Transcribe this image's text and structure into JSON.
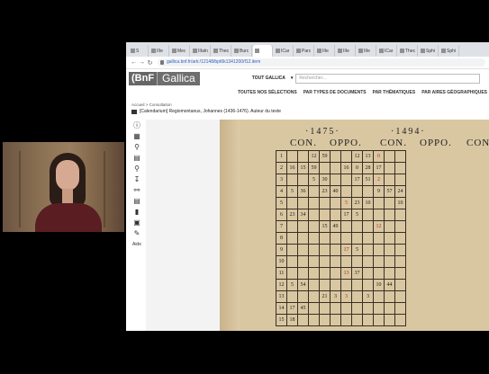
{
  "browser": {
    "tabs": [
      {
        "label": "S"
      },
      {
        "label": "IIIe"
      },
      {
        "label": "Mec"
      },
      {
        "label": "IIIaln"
      },
      {
        "label": "Thec"
      },
      {
        "label": "Burc"
      },
      {
        "label": "",
        "active": true
      },
      {
        "label": "ICar"
      },
      {
        "label": "Parc"
      },
      {
        "label": "IIIe"
      },
      {
        "label": "IIIe"
      },
      {
        "label": "IIIe"
      },
      {
        "label": "ICar"
      },
      {
        "label": "Thec"
      },
      {
        "label": "Sphi"
      },
      {
        "label": "Sphi"
      }
    ],
    "address": "gallica.bnf.fr/ark:/12148/bpt6k1341200/f12.item"
  },
  "header": {
    "logo_bnf": "(BnF",
    "logo_gallica": "Gallica",
    "scope": "TOUT GALLICA",
    "search_placeholder": "Rechercher..."
  },
  "nav": {
    "items": [
      "TOUTES NOS SÉLECTIONS",
      "PAR TYPES DE DOCUMENTS",
      "PAR THÉMATIQUES",
      "PAR AIRES GÉOGRAPHIQUES"
    ]
  },
  "breadcrumb": "Accueil > Consultation",
  "document": {
    "title": "[Calendarium] Regiomontanus, Johannes (1436-1476). Auteur du texte"
  },
  "sidebar": {
    "aide_label": "Aide"
  },
  "scan": {
    "years": [
      "·1475·",
      "·1494·"
    ],
    "labels": [
      "CON.",
      "OPPO.",
      "CON.",
      "OPPO.",
      "CON"
    ],
    "rows": [
      [
        "1",
        "",
        "",
        "12",
        "59",
        "",
        "",
        "12",
        "13",
        "0",
        "",
        ""
      ],
      [
        "2",
        "16",
        "15",
        "59",
        "",
        "",
        "16",
        "0",
        "28",
        "17",
        "",
        ""
      ],
      [
        "3",
        "",
        "",
        "5",
        "30",
        "",
        "",
        "17",
        "51",
        "2",
        "",
        ""
      ],
      [
        "4",
        "5",
        "36",
        "",
        "23",
        "40",
        "",
        "",
        "",
        "9",
        "57",
        "24"
      ],
      [
        "5",
        "",
        "",
        "",
        "",
        "",
        "5",
        "23",
        "10",
        "",
        "",
        "10"
      ],
      [
        "6",
        "23",
        "34",
        "",
        "",
        "",
        "17",
        "5",
        "",
        "",
        "",
        ""
      ],
      [
        "7",
        "",
        "",
        "",
        "15",
        "49",
        "",
        "",
        "",
        "12",
        "",
        ""
      ],
      [
        "8",
        "",
        "",
        "",
        "",
        "",
        "",
        "",
        "",
        "",
        "",
        ""
      ],
      [
        "9",
        "",
        "",
        "",
        "",
        "",
        "17",
        "5",
        "",
        "",
        "",
        ""
      ],
      [
        "10",
        "",
        "",
        "",
        "",
        "",
        "",
        "",
        "",
        "",
        "",
        ""
      ],
      [
        "11",
        "",
        "",
        "",
        "",
        "",
        "13",
        "37",
        "",
        "",
        "",
        ""
      ],
      [
        "12",
        "5",
        "54",
        "",
        "",
        "",
        "",
        "",
        "",
        "10",
        "44",
        ""
      ],
      [
        "13",
        "",
        "",
        "",
        "21",
        "3",
        "3",
        "",
        "3",
        "",
        "",
        ""
      ],
      [
        "14",
        "17",
        "45",
        "",
        "",
        "",
        "",
        "",
        "",
        "",
        "",
        ""
      ],
      [
        "15",
        "18",
        "",
        "",
        "",
        "",
        "",
        "",
        "",
        "",
        "",
        ""
      ]
    ]
  }
}
